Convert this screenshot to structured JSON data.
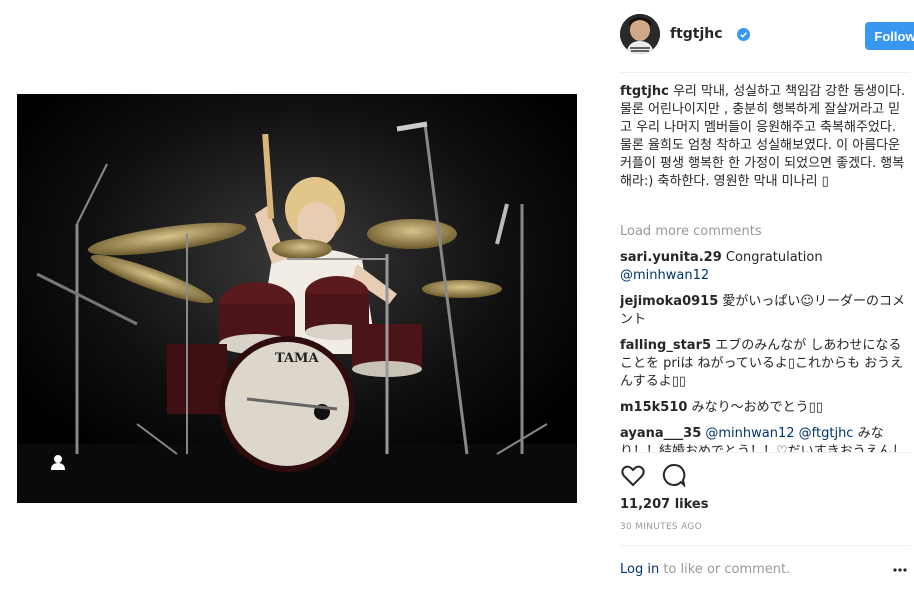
{
  "post": {
    "username": "ftgtjhc",
    "follow_label": "Follow",
    "caption_user": "ftgtjhc",
    "caption_text": "우리 막내, 성실하고 책임감 강한 동생이다. 물론 어린나이지만 , 충분히 행복하게 잘살꺼라고 믿고 우리 나머지 멤버들이 응원해주고 축복해주었다. 물론 율희도 엄청 착하고 성실해보였다. 이 아름다운 커플이 평생 행복한 한 가정이 되었으면 좋겠다. 행복해라:) 축하한다. 영원한 막내 미나리 ▯",
    "load_more": "Load more comments",
    "likes": "11,207 likes",
    "time": "30 MINUTES AGO",
    "login_link": "Log in",
    "login_rest": " to like or comment."
  },
  "comments": [
    {
      "user": "sari.yunita.29",
      "text": "Congratulation ",
      "mention": "@minhwan12",
      "after": ""
    },
    {
      "user": "jejimoka0915",
      "text": "愛がいっぱい☺リーダーのコメント",
      "mention": "",
      "after": ""
    },
    {
      "user": "falling_star5",
      "text": "エブのみんなが しあわせになることを priは ねがっているよ▯これからも おうえんするよ▯▯",
      "mention": "",
      "after": ""
    },
    {
      "user": "m15k510",
      "text": "みなり～おめでとう▯▯",
      "mention": "",
      "after": ""
    },
    {
      "user": "ayana___35",
      "text": "",
      "mention": "@minhwan12 @ftgtjhc",
      "after": " みなり！！結婚おめでとう！！♡だいすきおうえんしてます！！"
    }
  ],
  "photo": {
    "drum_brand": "TAMA"
  },
  "colors": {
    "accent": "#3897f0",
    "link": "#003569",
    "muted": "#999999"
  },
  "icons": [
    "verified-badge-icon",
    "heart-icon",
    "comment-bubble-icon",
    "user-tag-icon",
    "more-options-icon"
  ]
}
